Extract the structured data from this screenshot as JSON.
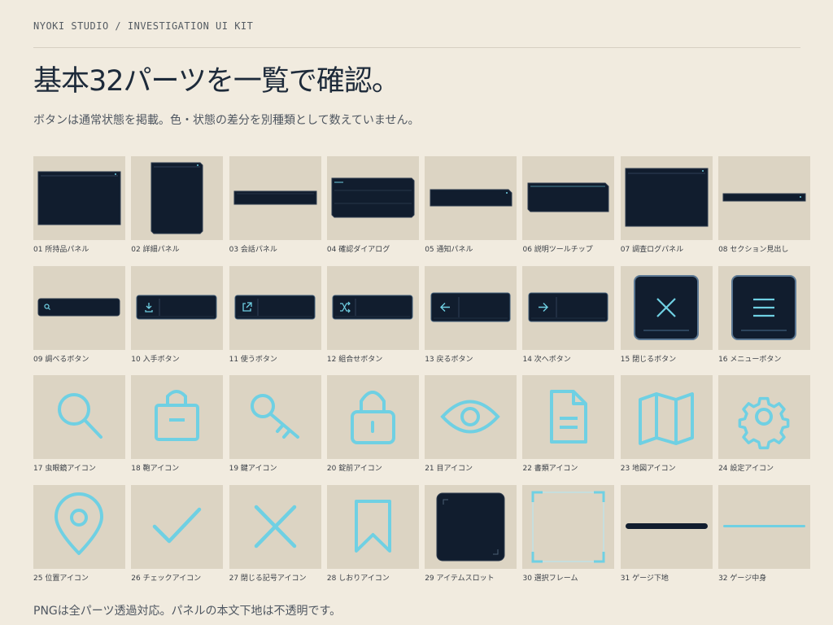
{
  "header": {
    "brand": "NYOKI STUDIO / INVESTIGATION UI KIT",
    "title": "基本32パーツを一覧で確認。",
    "subtitle": "ボタンは通常状態を掲載。色・状態の差分を別種類として数えていません。"
  },
  "footer": {
    "note": "PNGは全パーツ透過対応。パネルの本文下地は不透明です。"
  },
  "colors": {
    "page_background": "#f1ebdf",
    "tile_background": "#dcd4c3",
    "panel_navy": "#111d2e",
    "accent_cyan": "#6fd0e3"
  },
  "parts": [
    {
      "label": "01 所持品パネル",
      "icon": "panel-icon"
    },
    {
      "label": "02 詳細パネル",
      "icon": "panel-icon"
    },
    {
      "label": "03 会話パネル",
      "icon": "panel-icon"
    },
    {
      "label": "04 確認ダイアログ",
      "icon": "dialog-icon"
    },
    {
      "label": "05 通知パネル",
      "icon": "panel-icon"
    },
    {
      "label": "06 説明ツールチップ",
      "icon": "tooltip-icon"
    },
    {
      "label": "07 調査ログパネル",
      "icon": "panel-icon"
    },
    {
      "label": "08 セクション見出し",
      "icon": "header-bar-icon"
    },
    {
      "label": "09 調べるボタン",
      "icon": "search-icon"
    },
    {
      "label": "10 入手ボタン",
      "icon": "download-icon"
    },
    {
      "label": "11 使うボタン",
      "icon": "external-link-icon"
    },
    {
      "label": "12 組合せボタン",
      "icon": "shuffle-icon"
    },
    {
      "label": "13 戻るボタン",
      "icon": "arrow-left-icon"
    },
    {
      "label": "14 次へボタン",
      "icon": "arrow-right-icon"
    },
    {
      "label": "15 閉じるボタン",
      "icon": "close-icon"
    },
    {
      "label": "16 メニューボタン",
      "icon": "menu-icon"
    },
    {
      "label": "17 虫眼鏡アイコン",
      "icon": "magnifier-icon"
    },
    {
      "label": "18 鞄アイコン",
      "icon": "bag-icon"
    },
    {
      "label": "19 鍵アイコン",
      "icon": "key-icon"
    },
    {
      "label": "20 錠前アイコン",
      "icon": "padlock-icon"
    },
    {
      "label": "21 目アイコン",
      "icon": "eye-icon"
    },
    {
      "label": "22 書類アイコン",
      "icon": "document-icon"
    },
    {
      "label": "23 地図アイコン",
      "icon": "map-icon"
    },
    {
      "label": "24 設定アイコン",
      "icon": "gear-icon"
    },
    {
      "label": "25 位置アイコン",
      "icon": "location-pin-icon"
    },
    {
      "label": "26 チェックアイコン",
      "icon": "check-icon"
    },
    {
      "label": "27 閉じる記号アイコン",
      "icon": "close-mark-icon"
    },
    {
      "label": "28 しおりアイコン",
      "icon": "bookmark-icon"
    },
    {
      "label": "29 アイテムスロット",
      "icon": "item-slot-icon"
    },
    {
      "label": "30 選択フレーム",
      "icon": "selection-frame-icon"
    },
    {
      "label": "31 ゲージ下地",
      "icon": "gauge-base-icon"
    },
    {
      "label": "32 ゲージ中身",
      "icon": "gauge-fill-icon"
    }
  ]
}
